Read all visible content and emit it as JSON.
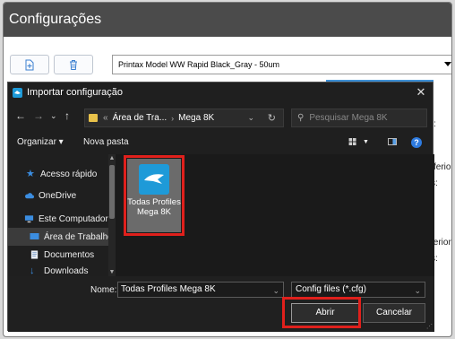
{
  "app": {
    "title": "Configurações",
    "printer_select": "Printax Model WW Rapid Black_Gray - 50um",
    "bg_fragments": [
      "ferior",
      "ferior:",
      ":",
      "s:",
      "s:"
    ]
  },
  "dialog": {
    "title": "Importar configuração",
    "close_glyph": "✕",
    "breadcrumb": [
      "«",
      "Área de Tra...",
      "Mega 8K"
    ],
    "search_placeholder": "Pesquisar Mega 8K",
    "organize_label": "Organizar ▾",
    "new_folder_label": "Nova pasta",
    "help_glyph": "?",
    "nav_items": [
      {
        "label": "Acesso rápido",
        "icon": "star-icon"
      },
      {
        "label": "OneDrive",
        "icon": "cloud-icon"
      },
      {
        "label": "Este Computador",
        "icon": "computer-icon"
      },
      {
        "label": "Área de Trabalho",
        "icon": "desktop-icon"
      },
      {
        "label": "Documentos",
        "icon": "document-icon"
      },
      {
        "label": "Downloads",
        "icon": "download-icon"
      }
    ],
    "files": [
      {
        "name": "Todas Profiles Mega 8K",
        "icon": "config-file-icon"
      }
    ],
    "filename_label": "Nome:",
    "filename_value": "Todas Profiles Mega 8K",
    "filetype_value": "Config files (*.cfg)",
    "open_button": "Abrir",
    "cancel_button": "Cancelar"
  },
  "colors": {
    "highlight": "#e0201c",
    "app_titlebar": "#4b4b4b",
    "dialog_bg": "#1f1f1f",
    "accent": "#2e7be0"
  }
}
